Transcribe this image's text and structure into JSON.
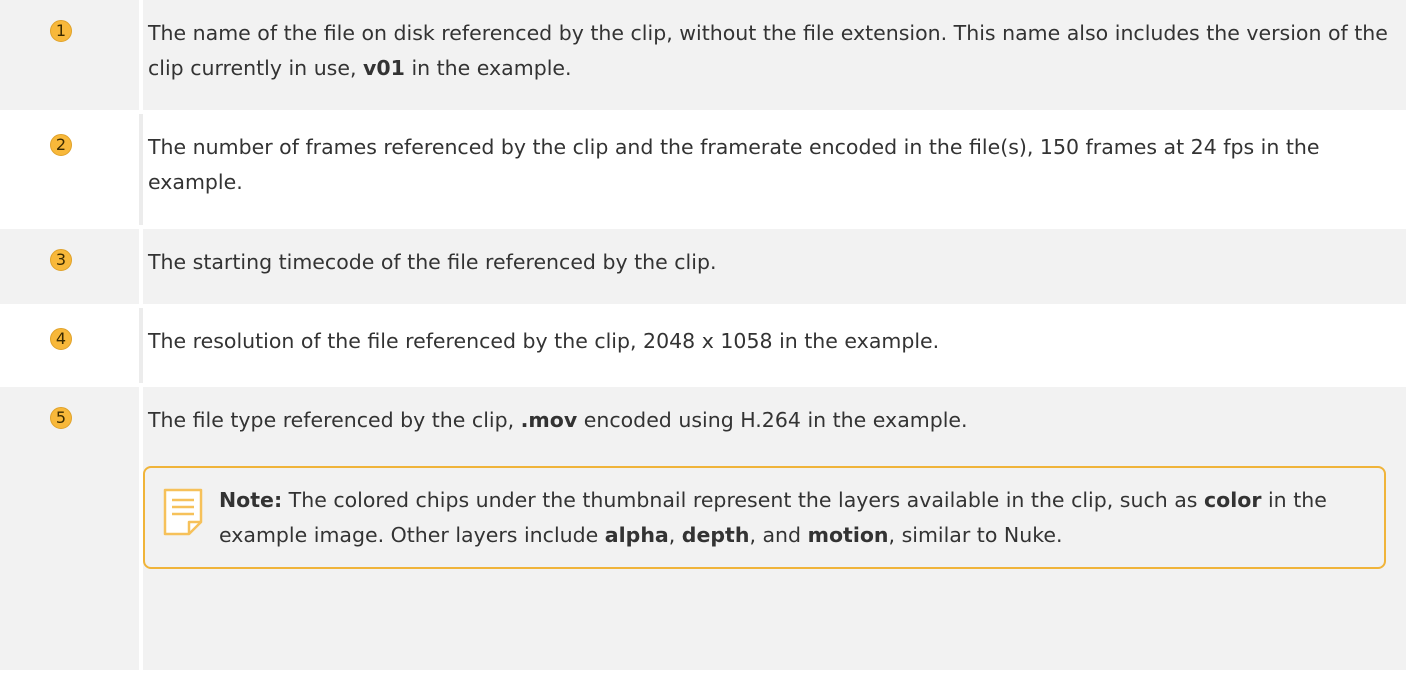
{
  "rows": [
    {
      "number": "1",
      "parts": [
        "The name of the file on disk referenced by the clip, without the file extension. This name also includes the version of the clip currently in use, ",
        "v01",
        " in the example."
      ]
    },
    {
      "number": "2",
      "text": "The number of frames referenced by the clip and the framerate encoded in the file(s), 150 frames at 24 fps in the example."
    },
    {
      "number": "3",
      "text": "The starting timecode of the file referenced by the clip."
    },
    {
      "number": "4",
      "text": "The resolution of the file referenced by the clip, 2048 x 1058 in the example."
    },
    {
      "number": "5",
      "parts": [
        "The file type referenced by the clip, ",
        ".mov",
        " encoded using H.264 in the example."
      ]
    }
  ],
  "note": {
    "label": "Note:",
    "parts": [
      " The colored chips under the thumbnail represent the layers available in the clip, such as ",
      "color",
      " in the example image. Other layers include ",
      "alpha",
      ", ",
      "depth",
      ", and ",
      "motion",
      ", similar to Nuke."
    ],
    "icon": "note-icon"
  },
  "colors": {
    "badge": "#f8b83a",
    "note_border": "#f0b43a",
    "row_shade": "#f2f2f2"
  }
}
